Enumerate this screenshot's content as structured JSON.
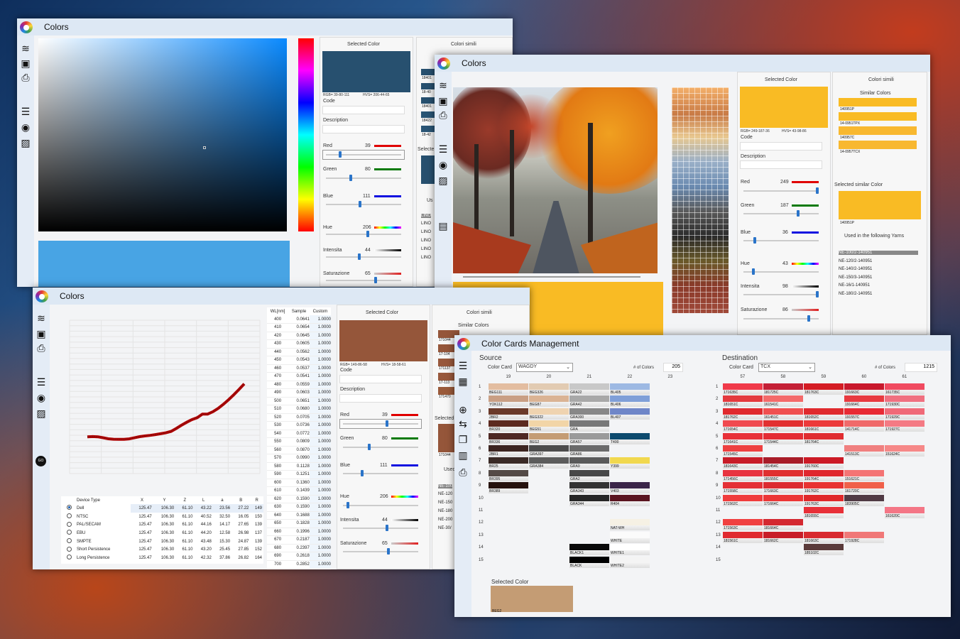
{
  "w1": {
    "title": "Colors",
    "sel_title": "Selected Color",
    "similar_title": "Colori simili",
    "rgb": "RGB= 39-80-111",
    "hvs": "HVS= 206-44-65",
    "code_label": "Code",
    "desc_label": "Description",
    "red_label": "Red",
    "red": "39",
    "green_label": "Green",
    "green": "80",
    "blue_label": "Blue",
    "blue": "111",
    "hue_label": "Hue",
    "hue": "206",
    "int_label": "Intensita",
    "int": "44",
    "sat_label": "Saturazione",
    "sat": "65",
    "swatch_codes": [
      "18401",
      "18-40",
      "18401",
      "18422",
      "18-42"
    ],
    "selected_label": "Selecte",
    "used_label": "Us",
    "yarns": [
      "LINO",
      "LINO",
      "LINO",
      "LINO",
      "LINO",
      "LINO"
    ],
    "color": "#27506f",
    "preview_color": "#48a4e4"
  },
  "w2": {
    "title": "Colors",
    "sel_title": "Selected Color",
    "similar_title": "Colori simili",
    "similar_sub": "Similar Colors",
    "rgb": "RGB= 249-187-36",
    "hvs": "HVS= 43-98-86",
    "code_label": "Code",
    "desc_label": "Description",
    "red_label": "Red",
    "red": "249",
    "green_label": "Green",
    "green": "187",
    "blue_label": "Blue",
    "blue": "36",
    "hue_label": "Hue",
    "hue": "43",
    "int_label": "Intensita",
    "int": "98",
    "sat_label": "Saturazione",
    "sat": "86",
    "similar": [
      "140951P",
      "14-0951TPX",
      "140957C",
      "14-0957TCX"
    ],
    "selected_similar_label": "Selected similar Color",
    "selected_similar_code": "140951P",
    "used_label": "Used in the following Yarns",
    "yarns": [
      "NE-100/2-140951",
      "NE-120/2-140951",
      "NE-140/2-140951",
      "NE-150/3-140951",
      "NE-16/1-140951",
      "NE-180/2-140951"
    ],
    "color": "#f9bb24"
  },
  "w3": {
    "title": "Colors",
    "sel_title": "Selected Color",
    "similar_title": "Colori simili",
    "similar_sub": "Similar Colors",
    "rgb": "RGB= 149-86-58",
    "hvs": "HVS= 18-58-61",
    "code_label": "Code",
    "desc_label": "Description",
    "red_label": "Red",
    "red": "39",
    "green_label": "Green",
    "green": "80",
    "blue_label": "Blue",
    "blue": "111",
    "hue_label": "Hue",
    "hue": "206",
    "int_label": "Intensita",
    "int": "44",
    "sat_label": "Saturazione",
    "sat": "65",
    "similar": [
      "171044",
      "17-104",
      "171137",
      "17-113",
      "171470"
    ],
    "selected_label": "Selected",
    "selected_code": "171044",
    "used_label": "Used",
    "yarns": [
      "NE-100",
      "NE-120",
      "NE-150",
      "NE-180",
      "NE-200",
      "NE-30/"
    ],
    "go": "GO",
    "color": "#95563a",
    "spec_headers": [
      "WL[nm]",
      "Sample",
      "Custom"
    ],
    "spec": [
      [
        "400",
        "0.0641",
        "1.0000"
      ],
      [
        "410",
        "0.0654",
        "1.0000"
      ],
      [
        "420",
        "0.0645",
        "1.0000"
      ],
      [
        "430",
        "0.0605",
        "1.0000"
      ],
      [
        "440",
        "0.0562",
        "1.0000"
      ],
      [
        "450",
        "0.0543",
        "1.0000"
      ],
      [
        "460",
        "0.0537",
        "1.0000"
      ],
      [
        "470",
        "0.0541",
        "1.0000"
      ],
      [
        "480",
        "0.0559",
        "1.0000"
      ],
      [
        "490",
        "0.0603",
        "1.0000"
      ],
      [
        "500",
        "0.0651",
        "1.0000"
      ],
      [
        "510",
        "0.0680",
        "1.0000"
      ],
      [
        "520",
        "0.0705",
        "1.0000"
      ],
      [
        "530",
        "0.0736",
        "1.0000"
      ],
      [
        "540",
        "0.0772",
        "1.0000"
      ],
      [
        "550",
        "0.0809",
        "1.0000"
      ],
      [
        "560",
        "0.0870",
        "1.0000"
      ],
      [
        "570",
        "0.0990",
        "1.0000"
      ],
      [
        "580",
        "0.1128",
        "1.0000"
      ],
      [
        "590",
        "0.1251",
        "1.0000"
      ],
      [
        "600",
        "0.1360",
        "1.0000"
      ],
      [
        "610",
        "0.1439",
        "1.0000"
      ],
      [
        "620",
        "0.1590",
        "1.0000"
      ],
      [
        "630",
        "0.1590",
        "1.0000"
      ],
      [
        "640",
        "0.1688",
        "1.0000"
      ],
      [
        "650",
        "0.1828",
        "1.0000"
      ],
      [
        "660",
        "0.1996",
        "1.0000"
      ],
      [
        "670",
        "0.2187",
        "1.0000"
      ],
      [
        "680",
        "0.2397",
        "1.0000"
      ],
      [
        "690",
        "0.2618",
        "1.0000"
      ],
      [
        "700",
        "0.2852",
        "1.0000"
      ]
    ],
    "dev_headers": [
      "Device Type",
      "X",
      "Y",
      "Z",
      "L",
      "a",
      "B",
      "R"
    ],
    "devices": [
      [
        "Dell",
        "125.47",
        "106.30",
        "61.10",
        "43.22",
        "23.56",
        "27.22",
        "149"
      ],
      [
        "NTSC",
        "125.47",
        "106.30",
        "61.10",
        "40.52",
        "32.50",
        "16.05",
        "150"
      ],
      [
        "PAL/SECAM",
        "125.47",
        "106.30",
        "61.10",
        "44.16",
        "14.17",
        "27.65",
        "139"
      ],
      [
        "EBU",
        "125.47",
        "106.30",
        "61.10",
        "44.20",
        "12.58",
        "26.98",
        "137"
      ],
      [
        "SMPTE",
        "125.47",
        "106.30",
        "61.10",
        "43.48",
        "15.30",
        "24.87",
        "139"
      ],
      [
        "Short Persistence",
        "125.47",
        "106.30",
        "61.10",
        "43.20",
        "25.45",
        "27.85",
        "152"
      ],
      [
        "Long Persistence",
        "125.47",
        "106.30",
        "61.10",
        "42.32",
        "37.86",
        "26.82",
        "164"
      ]
    ]
  },
  "w4": {
    "title": "Color Cards Management",
    "source_label": "Source",
    "dest_label": "Destination",
    "card_label": "Color Card",
    "ncolors_label": "# of Colors",
    "src_card": "WAGDY",
    "src_count": "205",
    "dst_card": "TCX",
    "dst_count": "1215",
    "src_cols": [
      "19",
      "20",
      "21",
      "22",
      "23"
    ],
    "dst_cols": [
      "57",
      "58",
      "59",
      "60",
      "61"
    ],
    "rows": [
      "1",
      "2",
      "3",
      "4",
      "5",
      "6",
      "7",
      "8",
      "9",
      "10",
      "11",
      "12",
      "13",
      "14",
      "15"
    ],
    "src_cells": [
      [
        "BEG111",
        "#e3bda0",
        0,
        0
      ],
      [
        "YOK112",
        "#c99f84",
        0,
        1
      ],
      [
        "2BR2",
        "#6b3a2a",
        0,
        2
      ],
      [
        "BR320",
        "#5d2a20",
        0,
        3
      ],
      [
        "BR336",
        "#4e2824",
        0,
        4
      ],
      [
        "2BR1",
        "#3c2420",
        0,
        5
      ],
      [
        "BR25",
        "#3a2a26",
        0,
        6
      ],
      [
        "BR395",
        "#544a46",
        0,
        7
      ],
      [
        "BR389",
        "#26120e",
        0,
        8
      ],
      [
        "BEG326",
        "#e2cbb2",
        1,
        0
      ],
      [
        "BEG87",
        "#dab394",
        1,
        1
      ],
      [
        "BEG322",
        "#efd3b0",
        1,
        2
      ],
      [
        "BEG51",
        "#f2d5a7",
        1,
        3
      ],
      [
        "BEG2",
        "#c49c74",
        1,
        4
      ],
      [
        "GRA397",
        "#4c4c4c",
        1,
        5
      ],
      [
        "GRA384",
        "#5c5c5c",
        1,
        6
      ],
      [
        "GRA22",
        "#c8c8c8",
        2,
        0
      ],
      [
        "GRA42",
        "#a8a8a8",
        2,
        1
      ],
      [
        "GRA300",
        "#888888",
        2,
        2
      ],
      [
        "GRA",
        "#787878",
        2,
        3
      ],
      [
        "GRA57",
        "#9a9a9a",
        2,
        4
      ],
      [
        "GRA86",
        "#6a6a6a",
        2,
        5
      ],
      [
        "GRA9",
        "#5a5a5a",
        2,
        6
      ],
      [
        "GRA2",
        "#484848",
        2,
        7
      ],
      [
        "GRA343",
        "#333333",
        2,
        8
      ],
      [
        "GRA344",
        "#262626",
        2,
        9
      ],
      [
        "BLACK1",
        "#0a0a0a",
        2,
        13
      ],
      [
        "BLACK",
        "#000000",
        2,
        14
      ],
      [
        "BL405",
        "#9db9e3",
        3,
        0
      ],
      [
        "BL406",
        "#7f9fd8",
        3,
        1
      ],
      [
        "BL407",
        "#6f86c8",
        3,
        2
      ],
      [
        "T400",
        "#0d4a6e",
        3,
        4
      ],
      [
        "Y399",
        "#f1d84e",
        3,
        6
      ],
      [
        "V403",
        "#3a2448",
        3,
        8
      ],
      [
        "R404",
        "#5a1420",
        3,
        9
      ],
      [
        "NAT-WH",
        "#f6f1e4",
        3,
        11
      ],
      [
        "WHITE",
        "#fbfbfb",
        3,
        12
      ],
      [
        "WHITE1",
        "#ffffff",
        3,
        13
      ],
      [
        "WHITE2",
        "#f4f4f4",
        3,
        14
      ]
    ],
    "dst_cells": [
      [
        "171635C",
        "#f03a4a",
        0,
        0
      ],
      [
        "181651C",
        "#e43a3e",
        0,
        1
      ],
      [
        "181762C",
        "#e02a2e",
        0,
        2
      ],
      [
        "171654C",
        "#f04a50",
        0,
        3
      ],
      [
        "171641C",
        "#e83038",
        0,
        4
      ],
      [
        "171545C",
        "#ee4040",
        0,
        5
      ],
      [
        "181643C",
        "#c81c28",
        0,
        6
      ],
      [
        "171456C",
        "#e83440",
        0,
        7
      ],
      [
        "171558C",
        "#e43036",
        0,
        8
      ],
      [
        "171562C",
        "#f03c3c",
        0,
        9
      ],
      [
        "171563C",
        "#f04040",
        0,
        11
      ],
      [
        "181561C",
        "#e02a30",
        0,
        12
      ],
      [
        "181725C",
        "#c42036",
        1,
        0
      ],
      [
        "161541C",
        "#f46a6a",
        1,
        1
      ],
      [
        "161451C",
        "#f05050",
        1,
        2
      ],
      [
        "171547C",
        "#e23030",
        1,
        3
      ],
      [
        "171544C",
        "#e42c34",
        1,
        4
      ],
      [
        "181454C",
        "#a81c28",
        1,
        6
      ],
      [
        "181555C",
        "#e03030",
        1,
        7
      ],
      [
        "171663C",
        "#dc2a30",
        1,
        8
      ],
      [
        "171664C",
        "#ec3636",
        1,
        9
      ],
      [
        "181664C",
        "#d42830",
        1,
        11
      ],
      [
        "181662C",
        "#c81c28",
        1,
        12
      ],
      [
        "181763C",
        "#d41c24",
        2,
        0
      ],
      [
        "181652C",
        "#e02a2e",
        2,
        2
      ],
      [
        "181661C",
        "#ec3a3a",
        2,
        3
      ],
      [
        "181764C",
        "#e02c30",
        2,
        4
      ],
      [
        "191760C",
        "#cc1a26",
        2,
        6
      ],
      [
        "191764C",
        "#e0282e",
        2,
        7
      ],
      [
        "191762C",
        "#e83232",
        2,
        8
      ],
      [
        "191763C",
        "#e0282a",
        2,
        9
      ],
      [
        "181655C",
        "#e83038",
        2,
        10
      ],
      [
        "181663C",
        "#d82a30",
        2,
        12
      ],
      [
        "185102C",
        "#5a3a3a",
        2,
        13
      ],
      [
        "191663C",
        "#c8182c",
        3,
        0
      ],
      [
        "191664C",
        "#e83a40",
        3,
        1
      ],
      [
        "191557C",
        "#e82a34",
        3,
        2
      ],
      [
        "141714C",
        "#f06a6a",
        3,
        3
      ],
      [
        "141513C",
        "#f08080",
        3,
        5
      ],
      [
        "151621C",
        "#f47474",
        3,
        7
      ],
      [
        "161720C",
        "#f0604a",
        3,
        8
      ],
      [
        "183905C",
        "#503a44",
        3,
        9
      ],
      [
        "171928C",
        "#f07878",
        3,
        12
      ],
      [
        "161735C",
        "#f04a60",
        4,
        0
      ],
      [
        "171930C",
        "#f07080",
        4,
        1
      ],
      [
        "171929C",
        "#f06a78",
        4,
        2
      ],
      [
        "171927C",
        "#f47a84",
        4,
        3
      ],
      [
        "151624C",
        "#f68888",
        4,
        5
      ],
      [
        "161620C",
        "#f47686",
        4,
        10
      ]
    ],
    "selected_label": "Selected Color",
    "selected_code": "BEG2",
    "selected_color": "#c49c74"
  }
}
